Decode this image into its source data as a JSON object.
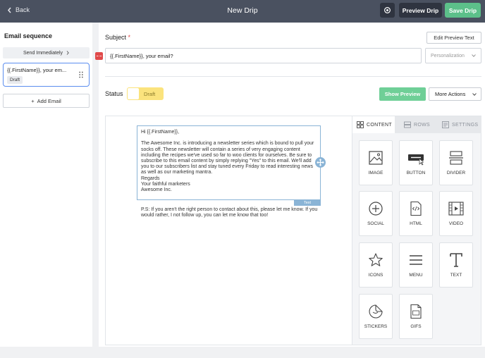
{
  "header": {
    "back_label": "Back",
    "title": "New Drip",
    "preview_label": "Preview Drip",
    "save_label": "Save Drip"
  },
  "sidebar": {
    "title": "Email sequence",
    "send_label": "Send Immediately",
    "emails": [
      {
        "subject": "{{.FirstName}}, your em...",
        "status": "Draft"
      }
    ],
    "add_label": "Add Email"
  },
  "subject": {
    "label": "Subject",
    "required_mark": "*",
    "value": "{{.FirstName}}, your email?",
    "edit_preview_label": "Edit Preview Text",
    "personalization_placeholder": "Personalization"
  },
  "status": {
    "label": "Status",
    "value": "Draft",
    "show_preview_label": "Show Preview",
    "more_actions_label": "More Actions"
  },
  "editor": {
    "body": "Hi {{.FirstName}},\n\nThe Awesome Inc. is introducing a newsletter series which is bound to pull your socks off. These newsletter will contain a series of very engaging content including the recipes we've used so far to woo clients for ourselves. Be sure to subscribe to this email content by simply replying \"Yes\" to this email. We'll add you to our subscribers list and stay tuned every Friday to read interesting news as well as our marketing mantra.\nRegards\nYour faithful marketers\nAwesome Inc.",
    "block_tag": "Text",
    "ps": "P.S: If you aren't the right person to contact about this, please let me know. If you would rather, I not follow up, you can let me know that too!"
  },
  "panel": {
    "tabs": [
      {
        "label": "CONTENT",
        "icon": "grid-icon",
        "active": true
      },
      {
        "label": "ROWS",
        "icon": "rows-icon",
        "active": false
      },
      {
        "label": "SETTINGS",
        "icon": "settings-icon",
        "active": false
      }
    ],
    "tiles": [
      {
        "label": "IMAGE",
        "icon": "image-icon"
      },
      {
        "label": "BUTTON",
        "icon": "button-icon"
      },
      {
        "label": "DIVIDER",
        "icon": "divider-icon"
      },
      {
        "label": "SOCIAL",
        "icon": "plus-circle-icon"
      },
      {
        "label": "HTML",
        "icon": "html-file-icon"
      },
      {
        "label": "VIDEO",
        "icon": "video-film-icon"
      },
      {
        "label": "ICONS",
        "icon": "star-icon"
      },
      {
        "label": "MENU",
        "icon": "menu-icon"
      },
      {
        "label": "TEXT",
        "icon": "text-t-icon"
      },
      {
        "label": "STICKERS",
        "icon": "sticker-icon"
      },
      {
        "label": "GIFS",
        "icon": "gif-file-icon"
      }
    ]
  },
  "colors": {
    "header_bg": "#4a5160",
    "save_green": "#5cc08a",
    "preview_green": "#6fcf97",
    "draft_yellow": "#fbe37d",
    "selection_blue": "#5b8def",
    "block_blue": "#8ab4d6",
    "required_red": "#e04a4a"
  }
}
